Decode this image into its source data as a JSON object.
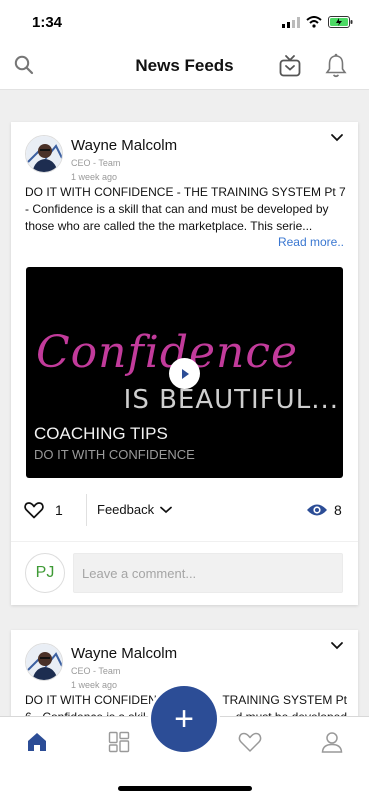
{
  "status_bar": {
    "time": "1:34"
  },
  "header": {
    "title": "News Feeds"
  },
  "posts": [
    {
      "author": "Wayne Malcolm",
      "role": "CEO - Team",
      "time": "1 week ago",
      "text": "DO IT WITH CONFIDENCE - THE TRAINING SYSTEM Pt 7 - Confidence is a skill that can and must be developed by those who are called the the marketplace. This serie...",
      "read_more": "Read more..",
      "video": {
        "script_text": "Confidence",
        "overlay_text": "IS BEAUTIFUL...",
        "caption_title": "COACHING TIPS",
        "caption_subtitle": "DO IT WITH CONFIDENCE"
      },
      "likes": "1",
      "feedback_label": "Feedback",
      "views": "8",
      "commenter_initials": "PJ",
      "comment_placeholder": "Leave a comment..."
    },
    {
      "author": "Wayne Malcolm",
      "role": "CEO - Team",
      "time": "1 week ago",
      "text_line1": "DO IT WITH CONFIDEN",
      "text_line1_end": "TRAINING SYSTEM Pt",
      "text_line2": "6 - Confidence is a skil",
      "text_line2_end": "d must be developed"
    }
  ],
  "tab_bar": {
    "items": [
      "home-icon",
      "grid-icon",
      "add-icon",
      "heart-icon",
      "profile-icon"
    ],
    "active": "home",
    "fab_label": "+"
  },
  "colors": {
    "accent": "#2c4d96",
    "link": "#3a77d1",
    "initials": "#3e9a35"
  }
}
